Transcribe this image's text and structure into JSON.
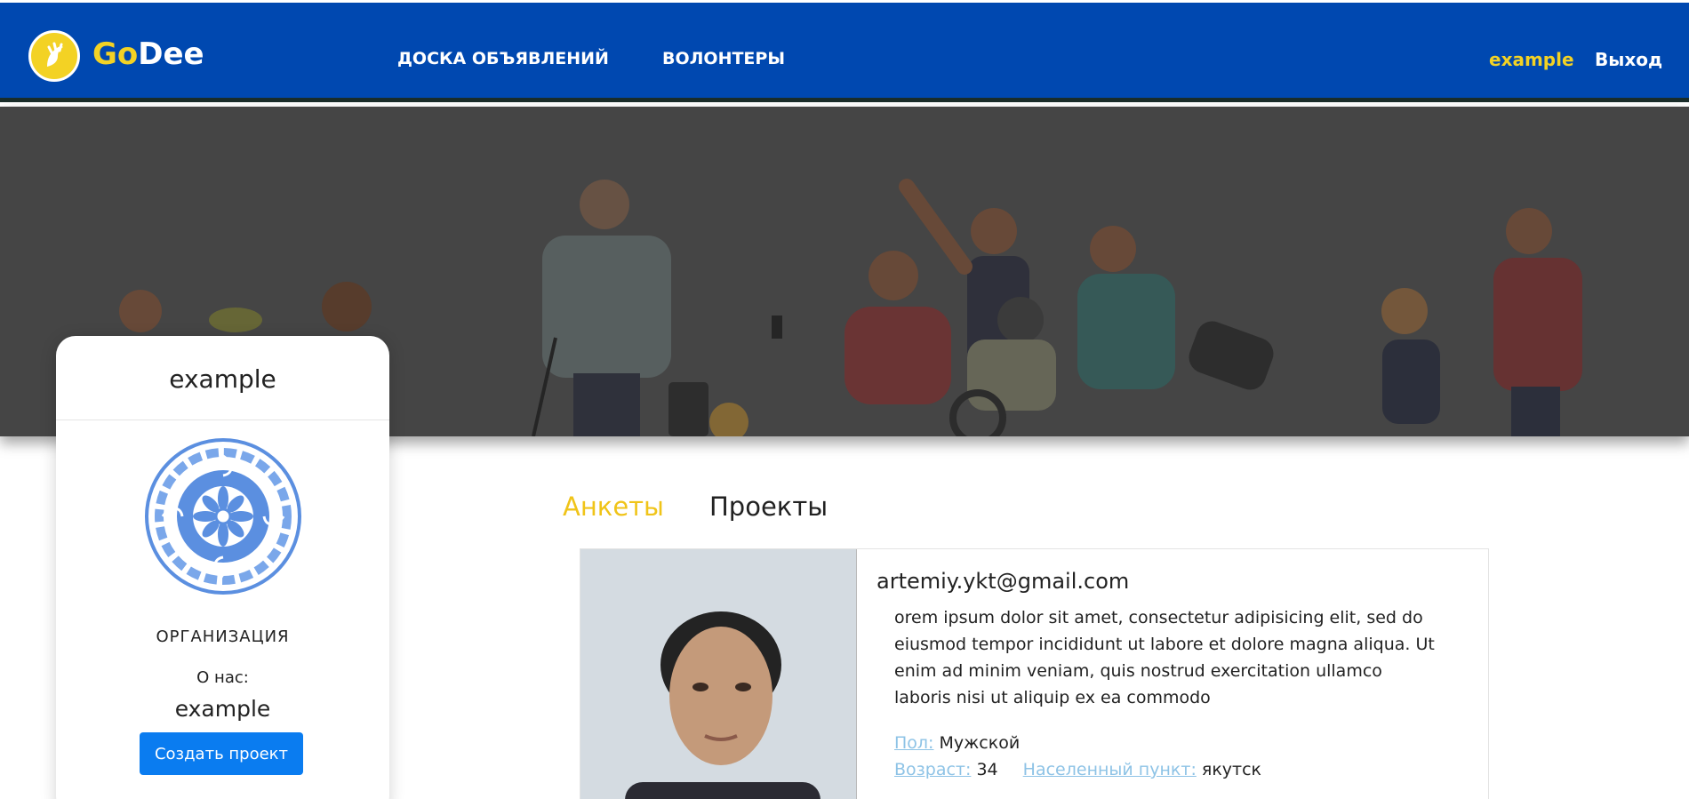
{
  "navbar": {
    "brand_go": "Go",
    "brand_dee": "Dee",
    "links": [
      "ДОСКА ОБЪЯВЛЕНИЙ",
      "ВОЛОНТЕРЫ"
    ],
    "user": "example",
    "logout": "Выход",
    "bg_color": "#0048b0",
    "accent_color": "#f3d224"
  },
  "profile": {
    "name": "example",
    "type": "ОРГАНИЗАЦИЯ",
    "about_label": "О нас:",
    "about_value": "example",
    "create_button": "Создать проект"
  },
  "tabs": {
    "active": "Анкеты",
    "inactive": "Проекты"
  },
  "volunteer": {
    "email": "artemiy.ykt@gmail.com",
    "description": "orem ipsum dolor sit amet, consectetur adipisicing elit, sed do eiusmod tempor incididunt ut labore et dolore magna aliqua. Ut enim ad minim veniam, quis nostrud exercitation ullamco laboris nisi ut aliquip ex ea commodo",
    "gender_label": "Пол:",
    "gender_value": "Мужской",
    "age_label": "Возраст:",
    "age_value": "34",
    "city_label": "Населенный пункт:",
    "city_value": "якутск"
  }
}
